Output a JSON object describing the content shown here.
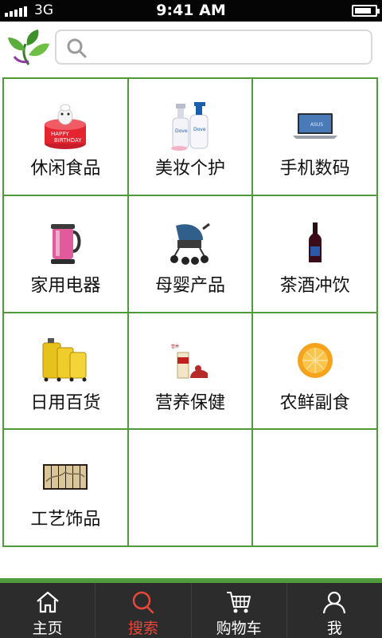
{
  "status_bar": {
    "network": "3G",
    "time": "9:41 AM",
    "battery_level": 0.85
  },
  "header": {
    "search_placeholder": ""
  },
  "categories": [
    {
      "label": "休闲食品",
      "icon": "birthday-cake"
    },
    {
      "label": "美妆个护",
      "icon": "dove-bottles"
    },
    {
      "label": "手机数码",
      "icon": "asus-laptop"
    },
    {
      "label": "家用电器",
      "icon": "electric-kettle"
    },
    {
      "label": "母婴产品",
      "icon": "baby-stroller"
    },
    {
      "label": "茶酒冲饮",
      "icon": "wine-bottle"
    },
    {
      "label": "日用百货",
      "icon": "luggage-set"
    },
    {
      "label": "营养保健",
      "icon": "health-supplement"
    },
    {
      "label": "农鲜副食",
      "icon": "orange-slices"
    },
    {
      "label": "工艺饰品",
      "icon": "folding-screen"
    }
  ],
  "tabbar": {
    "items": [
      {
        "label": "主页",
        "icon": "home-icon"
      },
      {
        "label": "搜索",
        "icon": "search-icon"
      },
      {
        "label": "购物车",
        "icon": "cart-icon"
      },
      {
        "label": "我",
        "icon": "user-icon"
      }
    ],
    "active_index": 1,
    "active_color": "#e8473a"
  },
  "colors": {
    "accent_green": "#4f9a3a",
    "tabbar_bg": "#2c2c2c"
  }
}
